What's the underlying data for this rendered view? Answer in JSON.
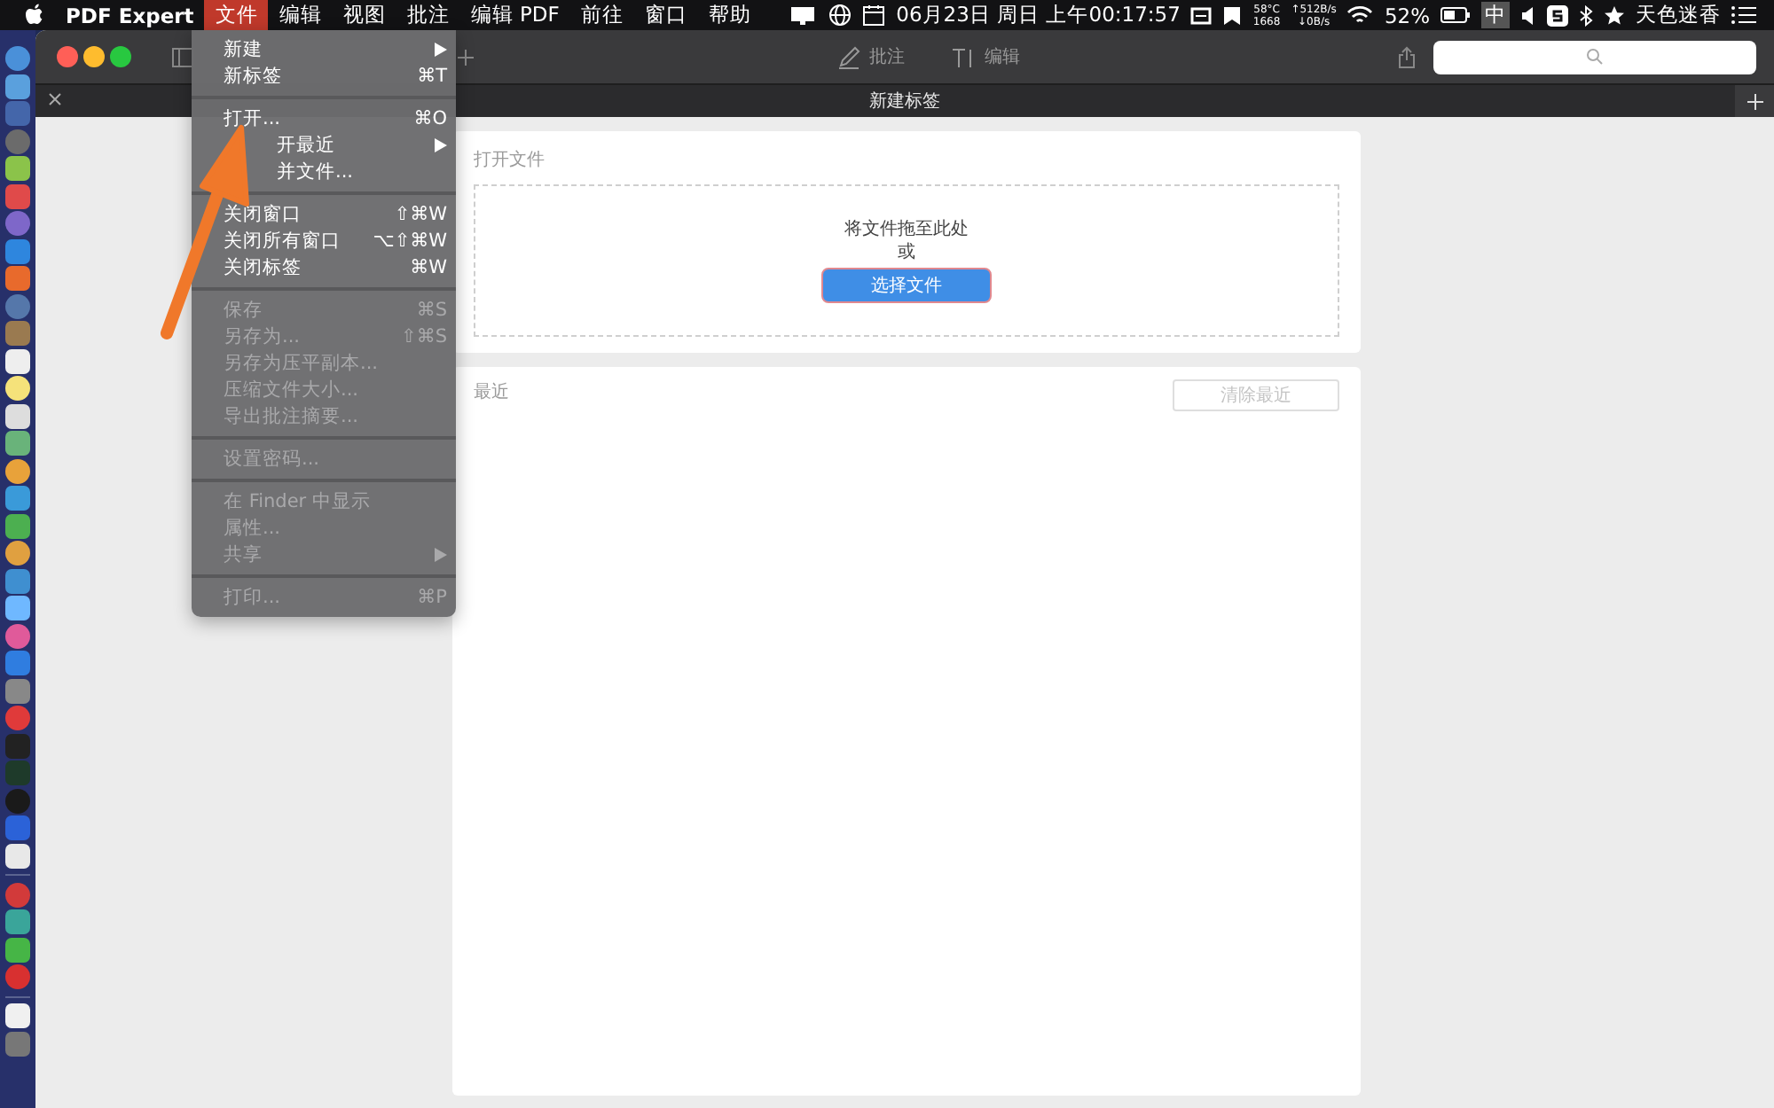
{
  "menubar": {
    "app_name": "PDF Expert",
    "menus": [
      {
        "label": "文件",
        "selected": true
      },
      {
        "label": "编辑",
        "selected": false
      },
      {
        "label": "视图",
        "selected": false
      },
      {
        "label": "批注",
        "selected": false
      },
      {
        "label": "编辑 PDF",
        "selected": false
      },
      {
        "label": "前往",
        "selected": false
      },
      {
        "label": "窗口",
        "selected": false
      },
      {
        "label": "帮助",
        "selected": false
      }
    ],
    "status": {
      "date_time": "06月23日 周日 上午00:17:57",
      "temperature": "58°C",
      "fan": "1668",
      "upload": "↑512B/s",
      "download": "↓0B/s",
      "battery": "52%",
      "input_method": "中",
      "user": "天色迷香"
    }
  },
  "toolbar": {
    "buttons": [
      {
        "kind": "pen",
        "label": "批注"
      },
      {
        "kind": "text",
        "label": "编辑"
      }
    ]
  },
  "tab_bar": {
    "title": "新建标签"
  },
  "file_menu": {
    "groups": [
      [
        {
          "label": "新建",
          "submenu": true,
          "disabled": false
        },
        {
          "label": "新标签",
          "shortcut": "⌘T",
          "submenu": false,
          "disabled": false
        }
      ],
      [
        {
          "label": "打开...",
          "shortcut": "⌘O",
          "submenu": false,
          "disabled": false
        },
        {
          "label": "开最近",
          "submenu": true,
          "disabled": false
        },
        {
          "label": "并文件...",
          "submenu": false,
          "disabled": false
        }
      ],
      [
        {
          "label": "关闭窗口",
          "shortcut": "⇧⌘W",
          "submenu": false,
          "disabled": false
        },
        {
          "label": "关闭所有窗口",
          "shortcut": "⌥⇧⌘W",
          "submenu": false,
          "disabled": false
        },
        {
          "label": "关闭标签",
          "shortcut": "⌘W",
          "submenu": false,
          "disabled": false
        }
      ],
      [
        {
          "label": "保存",
          "shortcut": "⌘S",
          "submenu": false,
          "disabled": true
        },
        {
          "label": "另存为...",
          "shortcut": "⇧⌘S",
          "submenu": false,
          "disabled": true
        },
        {
          "label": "另存为压平副本...",
          "submenu": false,
          "disabled": true
        },
        {
          "label": "压缩文件大小...",
          "submenu": false,
          "disabled": true
        },
        {
          "label": "导出批注摘要...",
          "submenu": false,
          "disabled": true
        }
      ],
      [
        {
          "label": "设置密码...",
          "submenu": false,
          "disabled": true
        }
      ],
      [
        {
          "label": "在 Finder 中显示",
          "submenu": false,
          "disabled": true
        },
        {
          "label": "属性...",
          "submenu": false,
          "disabled": true
        },
        {
          "label": "共享",
          "submenu": true,
          "disabled": true
        }
      ],
      [
        {
          "label": "打印...",
          "shortcut": "⌘P",
          "submenu": false,
          "disabled": true
        }
      ]
    ]
  },
  "open_file": {
    "title": "打开文件",
    "drop_text": "将文件拖至此处",
    "or_text": "或",
    "button": "选择文件"
  },
  "recent": {
    "title": "最近",
    "clear_button": "清除最近"
  }
}
